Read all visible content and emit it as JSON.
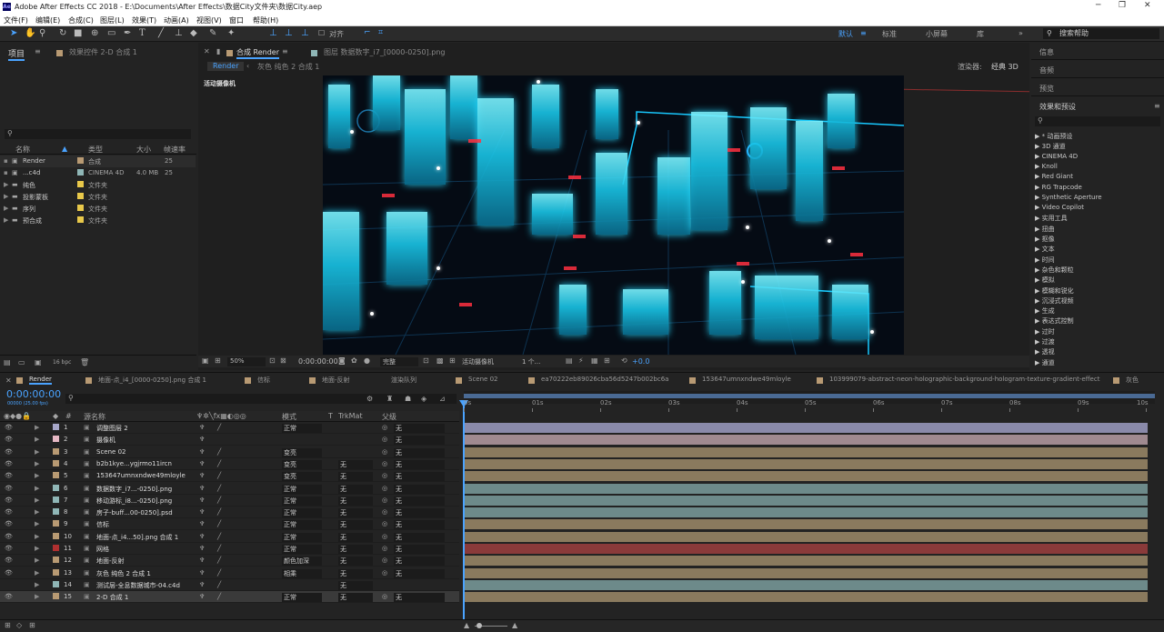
{
  "window": {
    "title": "Adobe After Effects CC 2018 - E:\\Documents\\After Effects\\数据City文件夹\\数据City.aep"
  },
  "menu": [
    "文件(F)",
    "编辑(E)",
    "合成(C)",
    "图层(L)",
    "效果(T)",
    "动画(A)",
    "视图(V)",
    "窗口",
    "帮助(H)"
  ],
  "toolbar": {
    "snap_label": "对齐"
  },
  "workspaces": [
    "默认",
    "标准",
    "小屏幕",
    "库"
  ],
  "search_help": "搜索帮助",
  "project": {
    "tab": "项目",
    "fx_tab": "效果控件 2-D 合成 1",
    "headers": {
      "name": "名称",
      "type": "类型",
      "size": "大小",
      "fps": "帧速率"
    },
    "items": [
      {
        "name": "Render",
        "type": "合成",
        "size": "",
        "fps": "25",
        "color": "#b89a73"
      },
      {
        "name": "...c4d",
        "type": "CINEMA 4D",
        "size": "4.0 MB",
        "fps": "25",
        "color": "#8fb6b6"
      },
      {
        "name": "纯色",
        "type": "文件夹",
        "size": "",
        "fps": "",
        "color": "#e8c84a"
      },
      {
        "name": "投影蒙板",
        "type": "文件夹",
        "size": "",
        "fps": "",
        "color": "#e8c84a"
      },
      {
        "name": "序列",
        "type": "文件夹",
        "size": "",
        "fps": "",
        "color": "#e8c84a"
      },
      {
        "name": "预合成",
        "type": "文件夹",
        "size": "",
        "fps": "",
        "color": "#e8c84a"
      }
    ],
    "bpc": "16 bpc"
  },
  "comp": {
    "tab": "合成 Render",
    "footage_tab": "图层 数据数字_i7_[0000-0250].png",
    "breadcrumb": [
      "Render",
      "灰色 纯色 2 合成 1"
    ],
    "renderer_label": "渲染器:",
    "renderer_value": "经典 3D",
    "camera_label": "活动摄像机",
    "footer": {
      "zoom": "50%",
      "timecode": "0:00:00:00",
      "quality": "完整",
      "camera": "活动摄像机",
      "views": "1 个...",
      "exposure": "+0.0"
    }
  },
  "right_panel": {
    "info": "信息",
    "audio": "音频",
    "preview": "预览",
    "effects_title": "效果和预设",
    "effects": [
      "* 动画预设",
      "3D 通道",
      "CINEMA 4D",
      "Knoll",
      "Red Giant",
      "RG Trapcode",
      "Synthetic Aperture",
      "Video Copilot",
      "实用工具",
      "扭曲",
      "抠像",
      "文本",
      "时间",
      "杂色和颗粒",
      "模拟",
      "模糊和锐化",
      "沉浸式视频",
      "生成",
      "表达式控制",
      "过时",
      "过渡",
      "透视",
      "通道"
    ]
  },
  "timeline": {
    "tabs": [
      "Render",
      "地面-点_i4_[0000-0250].png 合成 1",
      "信标",
      "地面-反射",
      "渲染队列",
      "Scene 02",
      "ea70222eb89026cba56d5247b002bc6a",
      "153647umnxndwe49mloyle",
      "103999079-abstract-neon-holographic-background-hologram-texture-gradient-effect",
      "灰色"
    ],
    "timecode": "0:00:00:00",
    "timecode_sub": "00000 (25.00 fps)",
    "headers": {
      "num": "#",
      "name": "源名称",
      "mode": "模式",
      "t": "T",
      "trkmat": "TrkMat",
      "parent": "父级"
    },
    "ruler": [
      "0s",
      "01s",
      "02s",
      "03s",
      "04s",
      "05s",
      "06s",
      "07s",
      "08s",
      "09s",
      "10s"
    ],
    "layers": [
      {
        "n": "1",
        "name": "调整图层 2",
        "mode": "正常",
        "trk": "",
        "parent": "无",
        "color": "#a7a7c9",
        "bar": "#8a8aaa"
      },
      {
        "n": "2",
        "name": "摄像机",
        "mode": "",
        "trk": "",
        "parent": "无",
        "color": "#e6b8c4",
        "bar": "#a08a90"
      },
      {
        "n": "3",
        "name": "Scene 02",
        "mode": "变亮",
        "trk": "",
        "parent": "无",
        "color": "#b89a73",
        "bar": "#8a7a5e"
      },
      {
        "n": "4",
        "name": "b2b1kye...ygjrmo11ircn",
        "mode": "变亮",
        "trk": "无",
        "parent": "无",
        "color": "#b89a73",
        "bar": "#8a7a5e"
      },
      {
        "n": "5",
        "name": "153647umnxndwe49mloyle",
        "mode": "变亮",
        "trk": "无",
        "parent": "无",
        "color": "#b89a73",
        "bar": "#8a7a5e"
      },
      {
        "n": "6",
        "name": "数据数字_i7...-0250].png",
        "mode": "正常",
        "trk": "无",
        "parent": "无",
        "color": "#8fb6b6",
        "bar": "#6d8a8a"
      },
      {
        "n": "7",
        "name": "移动游标_i8...-0250].png",
        "mode": "正常",
        "trk": "无",
        "parent": "无",
        "color": "#8fb6b6",
        "bar": "#6d8a8a"
      },
      {
        "n": "8",
        "name": "房子-buff...00-0250].psd",
        "mode": "正常",
        "trk": "无",
        "parent": "无",
        "color": "#8fb6b6",
        "bar": "#6d8a8a"
      },
      {
        "n": "9",
        "name": "信标",
        "mode": "正常",
        "trk": "无",
        "parent": "无",
        "color": "#b89a73",
        "bar": "#8a7a5e"
      },
      {
        "n": "10",
        "name": "地面-点_i4...50].png 合成 1",
        "mode": "正常",
        "trk": "无",
        "parent": "无",
        "color": "#b89a73",
        "bar": "#8a7a5e"
      },
      {
        "n": "11",
        "name": "网格",
        "mode": "正常",
        "trk": "无",
        "parent": "无",
        "color": "#b03030",
        "bar": "#8a3a3a"
      },
      {
        "n": "12",
        "name": "地面-反射",
        "mode": "颜色加深",
        "trk": "无",
        "parent": "无",
        "color": "#b89a73",
        "bar": "#8a7a5e"
      },
      {
        "n": "13",
        "name": "灰色 纯色 2 合成 1",
        "mode": "相乘",
        "trk": "无",
        "parent": "无",
        "color": "#b89a73",
        "bar": "#8a7a5e"
      },
      {
        "n": "14",
        "name": "测试层-全息数据城市-04.c4d",
        "mode": "",
        "trk": "无",
        "parent": "",
        "color": "#8fb6b6",
        "bar": "#6d8a8a"
      },
      {
        "n": "15",
        "name": "2-D 合成 1",
        "mode": "正常",
        "trk": "无",
        "parent": "无",
        "color": "#b89a73",
        "bar": "#8a7a5e"
      }
    ]
  }
}
